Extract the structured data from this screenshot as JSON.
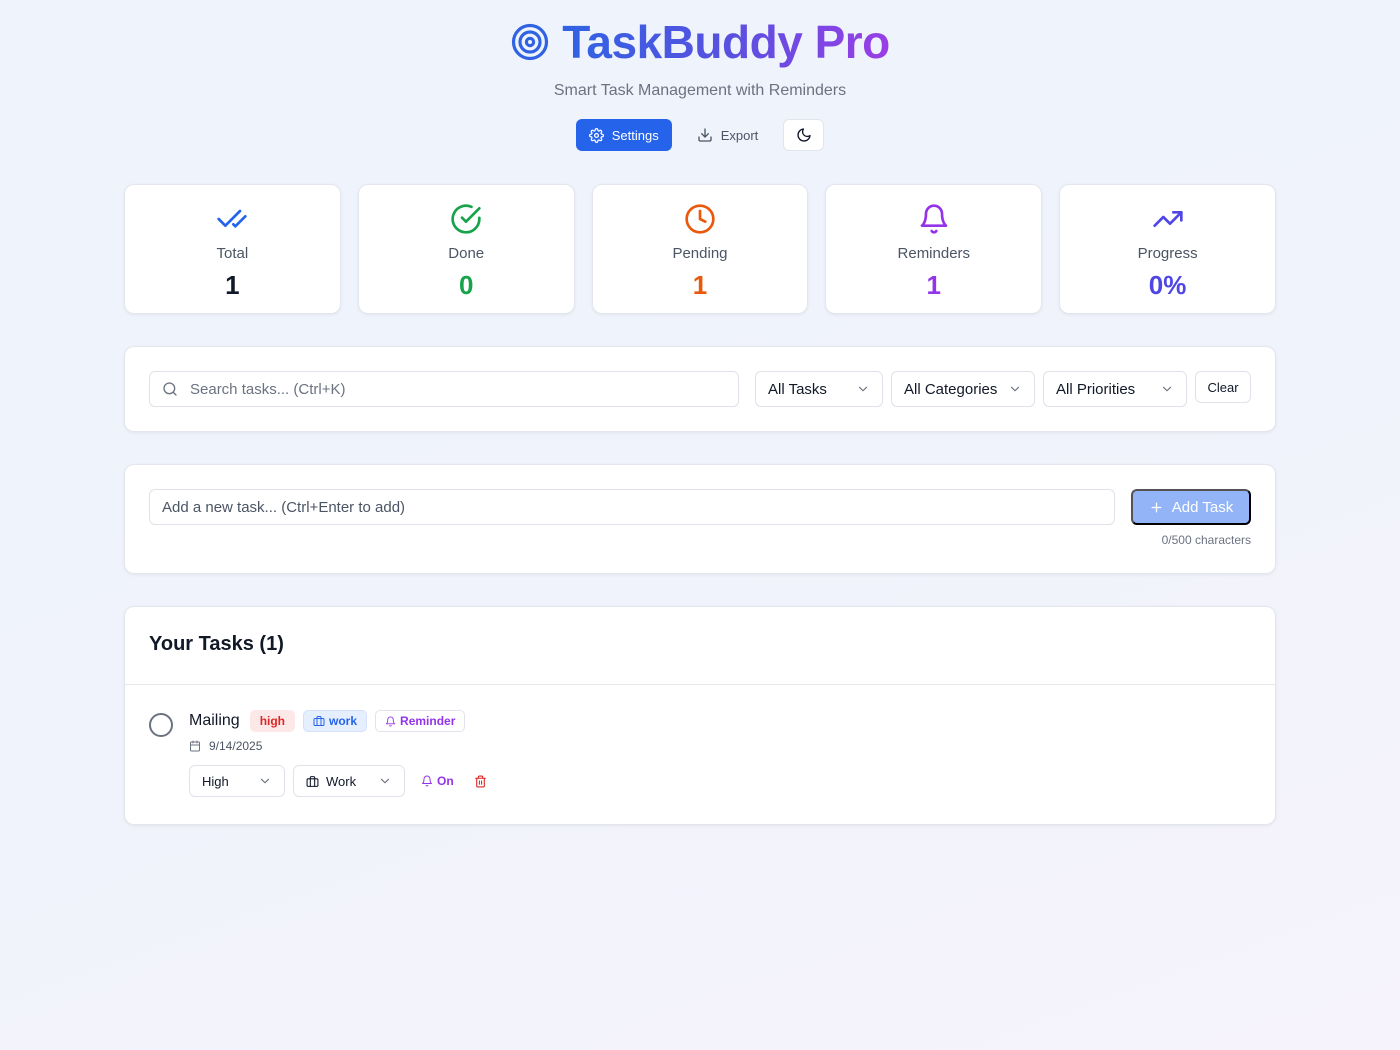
{
  "app": {
    "title": "TaskBuddy Pro",
    "subtitle": "Smart Task Management with Reminders",
    "accent": "#2563eb"
  },
  "toolbar": {
    "settings_label": "Settings",
    "export_label": "Export",
    "theme_icon": "moon-icon"
  },
  "stats": [
    {
      "label": "Total",
      "value": "1",
      "color": "#111827",
      "icon": "double-check-icon",
      "icon_color": "#2563eb"
    },
    {
      "label": "Done",
      "value": "0",
      "color": "#16a34a",
      "icon": "check-circle-icon",
      "icon_color": "#16a34a"
    },
    {
      "label": "Pending",
      "value": "1",
      "color": "#ea580c",
      "icon": "clock-icon",
      "icon_color": "#ea580c"
    },
    {
      "label": "Reminders",
      "value": "1",
      "color": "#9333ea",
      "icon": "bell-icon",
      "icon_color": "#9333ea"
    },
    {
      "label": "Progress",
      "value": "0%",
      "color": "#4f46e5",
      "icon": "trending-up-icon",
      "icon_color": "#4f46e5"
    }
  ],
  "filters": {
    "search_placeholder": "Search tasks... (Ctrl+K)",
    "status_value": "All Tasks",
    "category_value": "All Categories",
    "priority_value": "All Priorities",
    "clear_label": "Clear"
  },
  "composer": {
    "placeholder": "Add a new task... (Ctrl+Enter to add)",
    "add_label": "Add Task",
    "char_count": "0/500 characters"
  },
  "tasks": {
    "title": "Your Tasks (1)",
    "items": [
      {
        "name": "Mailing",
        "priority_badge": "high",
        "category_badge": "work",
        "reminder_badge": "Reminder",
        "date": "9/14/2025",
        "priority_value": "High",
        "category_value": "Work",
        "reminder_toggle": "On"
      }
    ]
  }
}
